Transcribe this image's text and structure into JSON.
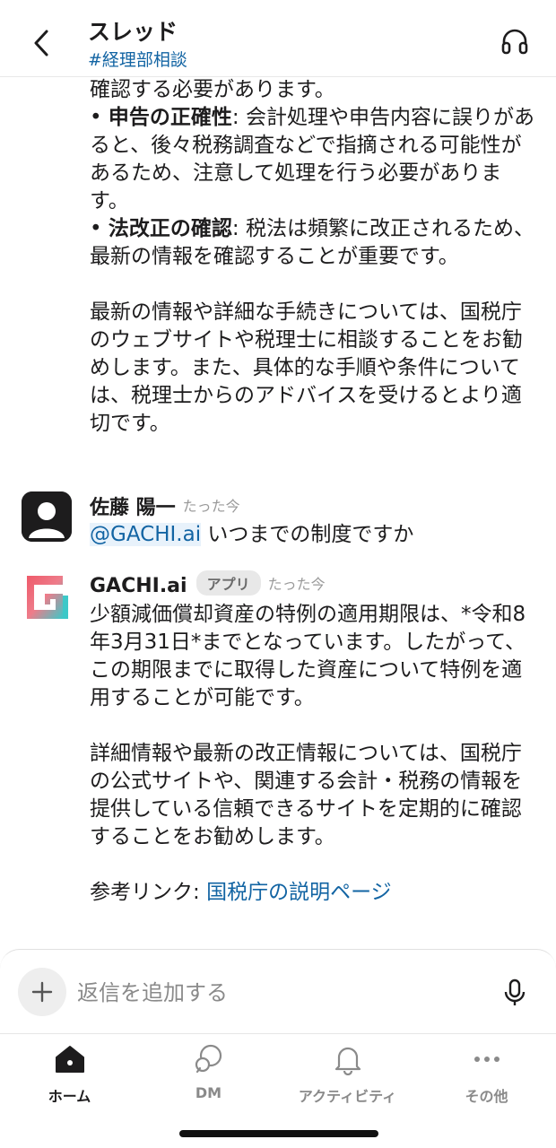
{
  "header": {
    "title": "スレッド",
    "channel": "#経理部相談"
  },
  "messages": {
    "continued": {
      "lines": [
        "確認する必要があります。"
      ],
      "bullets": [
        {
          "label": "申告の正確性",
          "text": ": 会計処理や申告内容に誤りがあると、後々税務調査などで指摘される可能性があるため、注意して処理を行う必要があります。"
        },
        {
          "label": "法改正の確認",
          "text": ": 税法は頻繁に改正されるため、最新の情報を確認することが重要です。"
        }
      ],
      "closing": "最新の情報や詳細な手続きについては、国税庁のウェブサイトや税理士に相談することをお勧めします。また、具体的な手順や条件については、税理士からのアドバイスを受けるとより適切です。"
    },
    "user_message": {
      "sender": "佐藤 陽一",
      "time": "たった今",
      "mention": "@GACHI.ai",
      "text": " いつまでの制度ですか"
    },
    "bot_message": {
      "sender": "GACHI.ai",
      "badge": "アプリ",
      "time": "たった今",
      "paragraph1": "少額減価償却資産の特例の適用期限は、*令和8年3月31日*までとなっています。したがって、この期限までに取得した資産について特例を適用することが可能です。",
      "paragraph2": "詳細情報や最新の改正情報については、国税庁の公式サイトや、関連する会計・税務の情報を提供している信頼できるサイトを定期的に確認することをお勧めします。",
      "reference_label": "参考リンク: ",
      "reference_link": "国税庁の説明ページ"
    }
  },
  "composer": {
    "placeholder": "返信を追加する"
  },
  "tabs": [
    {
      "label": "ホーム",
      "icon": "home-icon",
      "active": true
    },
    {
      "label": "DM",
      "icon": "dm-icon",
      "active": false
    },
    {
      "label": "アクティビティ",
      "icon": "bell-icon",
      "active": false
    },
    {
      "label": "その他",
      "icon": "more-icon",
      "active": false
    }
  ],
  "colors": {
    "link": "#1264a3",
    "text": "#1d1c1d",
    "muted": "#8a8a8a",
    "brand_red": "#e8505b",
    "brand_teal": "#3cc8c8"
  }
}
